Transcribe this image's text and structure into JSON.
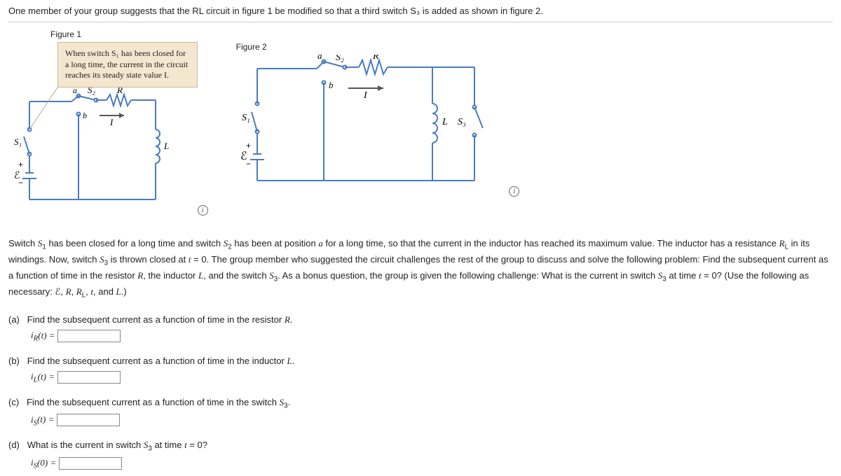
{
  "intro": "One member of your group suggests that the RL circuit in figure 1 be modified so that a third switch S₃ is added as shown in figure 2.",
  "figure1_label": "Figure 1",
  "figure2_label": "Figure 2",
  "callout_text": "When switch S₁ has been closed for a long time, the current in the circuit reaches its steady state value I.",
  "problem_text": "Switch S₁ has been closed for a long time and switch S₂ has been at position a for a long time, so that the current in the inductor has reached its maximum value. The inductor has a resistance R_L in its windings. Now, switch S₃ is thrown closed at t = 0. The group member who suggested the circuit challenges the rest of the group to discuss and solve the following problem: Find the subsequent current as a function of time in the resistor R, the inductor L, and the switch S₃. As a bonus question, the group is given the following challenge: What is the current in switch S₃ at time t = 0? (Use the following as necessary: ℰ, R, R_L, t, and L.)",
  "parts": {
    "a": {
      "label": "(a)",
      "prompt": "Find the subsequent current as a function of time in the resistor R.",
      "var": "i_R(t) ="
    },
    "b": {
      "label": "(b)",
      "prompt": "Find the subsequent current as a function of time in the inductor L.",
      "var": "i_L(t) ="
    },
    "c": {
      "label": "(c)",
      "prompt": "Find the subsequent current as a function of time in the switch S₃.",
      "var": "i_S(t) ="
    },
    "d": {
      "label": "(d)",
      "prompt": "What is the current in switch S₃ at time t = 0?",
      "var": "i_S(0) ="
    }
  },
  "circuit": {
    "S1": "S₁",
    "S2": "S₂",
    "S3": "S₃",
    "a": "a",
    "b": "b",
    "R": "R",
    "I": "I",
    "L": "L",
    "emf": "ℰ",
    "plus": "+",
    "minus": "−"
  }
}
